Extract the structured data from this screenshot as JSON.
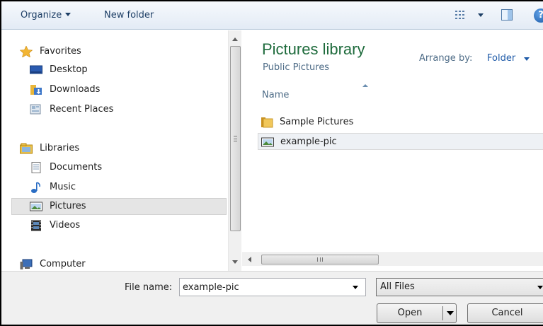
{
  "toolbar": {
    "organize_label": "Organize",
    "new_folder_label": "New folder",
    "icons": [
      "view-options-icon",
      "preview-pane-icon",
      "help-icon"
    ]
  },
  "nav": {
    "favorites": {
      "label": "Favorites",
      "icon": "star-icon"
    },
    "favorites_items": [
      {
        "label": "Desktop",
        "icon": "desktop-icon"
      },
      {
        "label": "Downloads",
        "icon": "downloads-folder-icon"
      },
      {
        "label": "Recent Places",
        "icon": "recent-places-icon"
      }
    ],
    "libraries": {
      "label": "Libraries",
      "icon": "libraries-icon"
    },
    "libraries_items": [
      {
        "label": "Documents",
        "icon": "documents-icon"
      },
      {
        "label": "Music",
        "icon": "music-icon"
      },
      {
        "label": "Pictures",
        "icon": "pictures-icon",
        "selected": true
      },
      {
        "label": "Videos",
        "icon": "videos-icon"
      }
    ],
    "computer": {
      "label": "Computer",
      "icon": "computer-icon"
    }
  },
  "content": {
    "library_title": "Pictures library",
    "library_subtitle": "Public Pictures",
    "arrange_label": "Arrange by:",
    "arrange_value": "Folder",
    "column_name": "Name",
    "files": [
      {
        "name": "Sample Pictures",
        "icon": "folder-icon",
        "selected": false
      },
      {
        "name": "example-pic",
        "icon": "image-file-icon",
        "selected": true
      }
    ]
  },
  "footer": {
    "file_name_label": "File name:",
    "file_name_value": "example-pic",
    "file_type_value": "All Files",
    "open_label": "Open",
    "cancel_label": "Cancel"
  },
  "colors": {
    "library_title": "#1e6b3c",
    "link_blue": "#1e5aa8",
    "toolbar_text": "#1e3f66"
  }
}
